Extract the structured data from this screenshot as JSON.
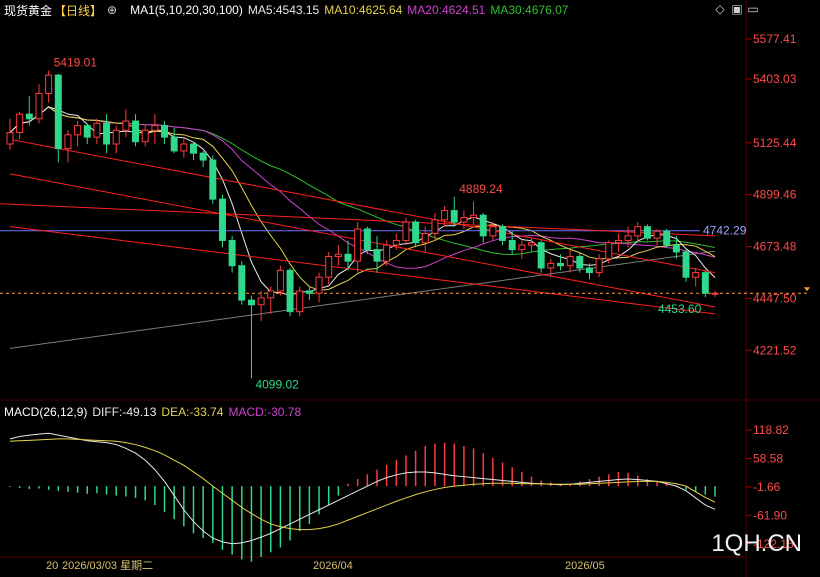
{
  "header": {
    "symbol": "现货黄金",
    "period": "【日线】",
    "settings_glyph": "⊕",
    "ma_title": "MA1(5,10,20,30,100)",
    "ma5": "MA5:4543.15",
    "ma10": "MA10:4625.64",
    "ma20": "MA20:4624.51",
    "ma30": "MA30:4676.07"
  },
  "macd_header": {
    "title": "MACD(26,12,9)",
    "diff": "DIFF:-49.13",
    "dea": "DEA:-33.74",
    "macd": "MACD:-30.78"
  },
  "watermark": "1QH.CN",
  "colors": {
    "bg": "#000000",
    "up": "#ff3b3b",
    "down": "#2fd88a",
    "axis_text": "#ff4a4a",
    "ma5": "#e8e8e8",
    "ma10": "#e6d24a",
    "ma20": "#d040d0",
    "ma30": "#30c030",
    "ma100": "#7a7a7a",
    "trend": "#ff2020",
    "hline": "#7070ff",
    "current": "#ff9a3c"
  },
  "chart_data": {
    "type": "candlestick",
    "title": "现货黄金 日线",
    "price_axis_labels": [
      "5577.41",
      "5403.03",
      "5125.44",
      "4899.46",
      "4673.48",
      "4447.50",
      "4221.52"
    ],
    "y_range": [
      4040,
      5660
    ],
    "x_labels": [
      "2026/03/03 星期二",
      "2026/04",
      "2026/05"
    ],
    "x_label_prefix": "20",
    "annotations": {
      "high": "5419.01",
      "low": "4099.02",
      "peak": "4889.24",
      "recent_low": "4453.60",
      "hline_value": "4742.29"
    },
    "hline_price": 4742.29,
    "current_price": 4470,
    "candles": [
      [
        5120,
        5230,
        5095,
        5170
      ],
      [
        5170,
        5260,
        5140,
        5250
      ],
      [
        5250,
        5330,
        5200,
        5230
      ],
      [
        5230,
        5380,
        5210,
        5340
      ],
      [
        5340,
        5440,
        5300,
        5420
      ],
      [
        5420,
        5425,
        5040,
        5100
      ],
      [
        5100,
        5180,
        5040,
        5160
      ],
      [
        5160,
        5220,
        5110,
        5200
      ],
      [
        5200,
        5210,
        5120,
        5150
      ],
      [
        5150,
        5230,
        5120,
        5210
      ],
      [
        5210,
        5250,
        5080,
        5120
      ],
      [
        5120,
        5200,
        5080,
        5180
      ],
      [
        5180,
        5270,
        5150,
        5220
      ],
      [
        5220,
        5250,
        5110,
        5130
      ],
      [
        5130,
        5200,
        5110,
        5180
      ],
      [
        5180,
        5250,
        5120,
        5200
      ],
      [
        5200,
        5220,
        5120,
        5150
      ],
      [
        5150,
        5190,
        5080,
        5090
      ],
      [
        5090,
        5150,
        5060,
        5120
      ],
      [
        5120,
        5130,
        5050,
        5080
      ],
      [
        5080,
        5090,
        5020,
        5050
      ],
      [
        5050,
        5070,
        4860,
        4880
      ],
      [
        4880,
        4900,
        4670,
        4700
      ],
      [
        4700,
        4720,
        4560,
        4590
      ],
      [
        4590,
        4610,
        4420,
        4440
      ],
      [
        4440,
        4460,
        4099,
        4420
      ],
      [
        4420,
        4480,
        4350,
        4450
      ],
      [
        4450,
        4500,
        4380,
        4480
      ],
      [
        4480,
        4590,
        4460,
        4570
      ],
      [
        4570,
        4580,
        4370,
        4390
      ],
      [
        4390,
        4500,
        4370,
        4480
      ],
      [
        4480,
        4500,
        4440,
        4470
      ],
      [
        4470,
        4560,
        4430,
        4540
      ],
      [
        4540,
        4650,
        4510,
        4630
      ],
      [
        4630,
        4680,
        4590,
        4640
      ],
      [
        4640,
        4700,
        4570,
        4610
      ],
      [
        4610,
        4780,
        4560,
        4750
      ],
      [
        4750,
        4760,
        4640,
        4660
      ],
      [
        4660,
        4720,
        4560,
        4610
      ],
      [
        4610,
        4700,
        4590,
        4680
      ],
      [
        4680,
        4730,
        4660,
        4700
      ],
      [
        4700,
        4800,
        4680,
        4780
      ],
      [
        4780,
        4790,
        4670,
        4690
      ],
      [
        4690,
        4760,
        4650,
        4730
      ],
      [
        4730,
        4820,
        4700,
        4790
      ],
      [
        4790,
        4850,
        4760,
        4830
      ],
      [
        4830,
        4890,
        4760,
        4780
      ],
      [
        4780,
        4830,
        4750,
        4800
      ],
      [
        4800,
        4870,
        4770,
        4810
      ],
      [
        4810,
        4820,
        4690,
        4720
      ],
      [
        4720,
        4780,
        4700,
        4760
      ],
      [
        4760,
        4770,
        4680,
        4700
      ],
      [
        4700,
        4740,
        4640,
        4660
      ],
      [
        4660,
        4700,
        4620,
        4680
      ],
      [
        4680,
        4710,
        4650,
        4690
      ],
      [
        4690,
        4700,
        4560,
        4580
      ],
      [
        4580,
        4620,
        4540,
        4600
      ],
      [
        4600,
        4640,
        4570,
        4590
      ],
      [
        4590,
        4660,
        4560,
        4630
      ],
      [
        4630,
        4650,
        4560,
        4580
      ],
      [
        4580,
        4600,
        4530,
        4560
      ],
      [
        4560,
        4640,
        4540,
        4620
      ],
      [
        4620,
        4700,
        4600,
        4690
      ],
      [
        4690,
        4730,
        4650,
        4700
      ],
      [
        4700,
        4760,
        4670,
        4720
      ],
      [
        4720,
        4780,
        4690,
        4760
      ],
      [
        4760,
        4770,
        4700,
        4710
      ],
      [
        4710,
        4750,
        4680,
        4740
      ],
      [
        4740,
        4750,
        4670,
        4680
      ],
      [
        4680,
        4720,
        4620,
        4650
      ],
      [
        4650,
        4660,
        4520,
        4540
      ],
      [
        4540,
        4580,
        4500,
        4560
      ],
      [
        4560,
        4570,
        4453,
        4470
      ],
      [
        4470,
        4480,
        4455,
        4470
      ]
    ],
    "macd_axis_labels": [
      "118.82",
      "58.58",
      "-1.66",
      "-61.90",
      "-122.15"
    ],
    "macd_y_range": [
      -150,
      140
    ],
    "macd_hist": [
      -2,
      -4,
      -6,
      -5,
      -8,
      -10,
      -12,
      -14,
      -16,
      -15,
      -18,
      -20,
      -22,
      -25,
      -30,
      -40,
      -55,
      -70,
      -85,
      -100,
      -110,
      -120,
      -135,
      -145,
      -155,
      -160,
      -150,
      -140,
      -130,
      -115,
      -95,
      -80,
      -60,
      -40,
      -20,
      5,
      15,
      25,
      35,
      45,
      55,
      65,
      75,
      85,
      90,
      92,
      90,
      85,
      80,
      70,
      60,
      50,
      40,
      30,
      20,
      12,
      8,
      5,
      3,
      10,
      15,
      20,
      25,
      30,
      28,
      22,
      15,
      10,
      5,
      -2,
      -8,
      -12,
      -18,
      -22
    ],
    "macd_diff": [
      100,
      105,
      108,
      110,
      112,
      108,
      104,
      100,
      96,
      94,
      92,
      88,
      80,
      70,
      55,
      35,
      10,
      -20,
      -50,
      -75,
      -95,
      -110,
      -118,
      -122,
      -120,
      -115,
      -108,
      -100,
      -90,
      -80,
      -70,
      -60,
      -50,
      -40,
      -30,
      -20,
      -10,
      0,
      10,
      18,
      24,
      28,
      30,
      30,
      28,
      25,
      22,
      20,
      18,
      16,
      14,
      12,
      10,
      8,
      6,
      5,
      4,
      3,
      4,
      6,
      8,
      10,
      12,
      14,
      15,
      14,
      12,
      10,
      5,
      0,
      -10,
      -25,
      -40,
      -49
    ],
    "macd_dea": [
      95,
      96,
      97,
      98,
      99,
      100,
      100,
      99,
      98,
      97,
      96,
      95,
      92,
      88,
      82,
      75,
      66,
      55,
      44,
      30,
      16,
      0,
      -15,
      -30,
      -45,
      -58,
      -70,
      -80,
      -86,
      -90,
      -92,
      -92,
      -90,
      -86,
      -80,
      -72,
      -64,
      -56,
      -48,
      -40,
      -32,
      -25,
      -18,
      -12,
      -7,
      -3,
      0,
      2,
      4,
      5,
      6,
      6,
      6,
      5,
      5,
      5,
      4,
      4,
      4,
      4,
      5,
      6,
      7,
      8,
      9,
      10,
      10,
      10,
      8,
      5,
      0,
      -12,
      -24,
      -34
    ]
  }
}
